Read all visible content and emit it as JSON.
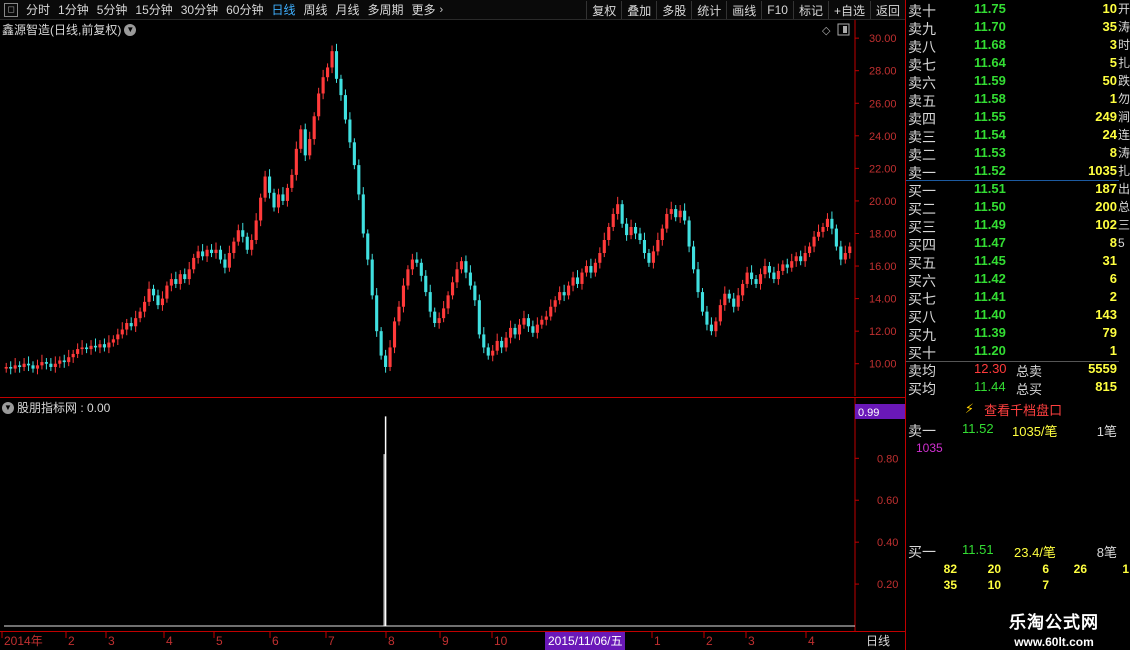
{
  "toolbar": {
    "periods": [
      "分时",
      "1分钟",
      "5分钟",
      "15分钟",
      "30分钟",
      "60分钟",
      "日线",
      "周线",
      "月线",
      "多周期",
      "更多"
    ],
    "active_index": 6,
    "right": [
      "复权",
      "叠加",
      "多股",
      "统计",
      "画线",
      "F10",
      "标记",
      "+自选",
      "返回"
    ]
  },
  "main_title": "鑫源智造(日线,前复权)",
  "indicator_title": "股朋指标网 : 0.00",
  "indicator_cursor_value": "0.99",
  "x_axis": {
    "labels": [
      "2014年",
      "2",
      "3",
      "4",
      "5",
      "6",
      "7",
      "8",
      "9",
      "10",
      "1",
      "2",
      "3",
      "4"
    ],
    "cursor_date": "2015/11/06/五",
    "period_label": "日线"
  },
  "colors": {
    "up": "#ff3a3a",
    "down": "#40e0e0",
    "grid": "#c00000",
    "accent_blue": "#3fb0ff"
  },
  "chart_data": [
    {
      "type": "candlestick",
      "y_ticks": [
        "30.00",
        "28.00",
        "26.00",
        "24.00",
        "22.00",
        "20.00",
        "18.00",
        "16.00",
        "14.00",
        "12.00",
        "10.00"
      ],
      "ylim": [
        9,
        30.5
      ],
      "close": [
        9.8,
        9.7,
        9.9,
        9.8,
        10.0,
        9.9,
        9.7,
        9.9,
        10.1,
        10.0,
        9.8,
        10.0,
        10.2,
        10.1,
        10.4,
        10.6,
        10.9,
        11.0,
        10.9,
        11.1,
        11.0,
        11.2,
        11.0,
        11.3,
        11.5,
        11.8,
        12.1,
        12.5,
        12.3,
        12.8,
        13.2,
        13.8,
        14.6,
        14.2,
        13.6,
        14.0,
        14.8,
        15.2,
        14.9,
        15.5,
        15.2,
        15.8,
        16.5,
        16.9,
        16.6,
        17.0,
        16.8,
        17.0,
        16.4,
        15.9,
        16.8,
        17.5,
        18.2,
        17.8,
        17.0,
        17.6,
        18.8,
        20.2,
        21.5,
        20.5,
        19.6,
        20.4,
        20.0,
        20.8,
        21.6,
        23.2,
        24.4,
        22.8,
        23.8,
        25.2,
        26.6,
        27.6,
        28.2,
        29.2,
        27.5,
        26.5,
        25.0,
        23.6,
        22.2,
        20.4,
        18.0,
        16.4,
        14.2,
        12.0,
        10.5,
        9.8,
        11.0,
        12.6,
        13.5,
        14.8,
        15.8,
        16.4,
        16.2,
        15.4,
        14.4,
        13.2,
        12.5,
        12.8,
        13.4,
        14.2,
        15.0,
        15.8,
        16.3,
        15.6,
        14.8,
        13.9,
        11.8,
        11.0,
        10.5,
        10.8,
        11.4,
        11.0,
        11.6,
        12.2,
        11.8,
        12.4,
        12.8,
        12.3,
        11.9,
        12.4,
        12.7,
        12.9,
        13.5,
        13.9,
        14.4,
        14.2,
        14.8,
        15.3,
        14.9,
        15.6,
        16.0,
        15.6,
        16.2,
        16.8,
        17.6,
        18.4,
        19.2,
        19.8,
        18.6,
        17.9,
        18.4,
        18.0,
        17.6,
        16.8,
        16.2,
        16.9,
        17.6,
        18.3,
        19.2,
        19.5,
        19.0,
        19.4,
        18.8,
        17.2,
        15.8,
        14.4,
        13.2,
        12.4,
        12.0,
        12.6,
        13.6,
        14.3,
        14.0,
        13.5,
        14.2,
        14.9,
        15.6,
        15.2,
        14.9,
        15.5,
        16.0,
        15.6,
        15.2,
        15.7,
        16.1,
        15.9,
        16.3,
        16.6,
        16.3,
        16.8,
        17.2,
        17.8,
        18.1,
        18.4,
        18.9,
        18.3,
        17.2,
        16.4,
        16.8,
        17.2
      ]
    },
    {
      "type": "bar",
      "y_ticks": [
        "0.80",
        "0.60",
        "0.40",
        "0.20"
      ],
      "ylim": [
        0,
        1.04
      ],
      "spike_index": 85,
      "spike_value": 1.0,
      "baseline": 0.0
    }
  ],
  "orderbook": {
    "asks": [
      {
        "label": "卖十",
        "price": "11.75",
        "vol": "10"
      },
      {
        "label": "卖九",
        "price": "11.70",
        "vol": "35"
      },
      {
        "label": "卖八",
        "price": "11.68",
        "vol": "3"
      },
      {
        "label": "卖七",
        "price": "11.64",
        "vol": "5"
      },
      {
        "label": "卖六",
        "price": "11.59",
        "vol": "50"
      },
      {
        "label": "卖五",
        "price": "11.58",
        "vol": "1"
      },
      {
        "label": "卖四",
        "price": "11.55",
        "vol": "249"
      },
      {
        "label": "卖三",
        "price": "11.54",
        "vol": "24"
      },
      {
        "label": "卖二",
        "price": "11.53",
        "vol": "8"
      },
      {
        "label": "卖一",
        "price": "11.52",
        "vol": "1035"
      }
    ],
    "bids": [
      {
        "label": "买一",
        "price": "11.51",
        "vol": "187"
      },
      {
        "label": "买二",
        "price": "11.50",
        "vol": "200"
      },
      {
        "label": "买三",
        "price": "11.49",
        "vol": "102"
      },
      {
        "label": "买四",
        "price": "11.47",
        "vol": "8"
      },
      {
        "label": "买五",
        "price": "11.45",
        "vol": "31"
      },
      {
        "label": "买六",
        "price": "11.42",
        "vol": "6"
      },
      {
        "label": "买七",
        "price": "11.41",
        "vol": "2"
      },
      {
        "label": "买八",
        "price": "11.40",
        "vol": "143"
      },
      {
        "label": "买九",
        "price": "11.39",
        "vol": "79"
      },
      {
        "label": "买十",
        "price": "11.20",
        "vol": "1"
      }
    ],
    "avg_sell_label": "卖均",
    "avg_sell_price": "12.30",
    "total_sell_label": "总卖",
    "total_sell": "5559",
    "avg_buy_label": "买均",
    "avg_buy_price": "11.44",
    "total_buy_label": "总买",
    "total_buy": "815"
  },
  "queue": {
    "button_label": "查看千档盘口",
    "sell_label": "卖一",
    "sell_price": "11.52",
    "sell_vol": "1035/笔",
    "sell_count": "1笔",
    "sell_orders": [
      "1035"
    ],
    "buy_label": "买一",
    "buy_price": "11.51",
    "buy_vol": "23.4/笔",
    "buy_count": "8笔",
    "buy_orders": [
      [
        "82",
        "20",
        "6",
        "26",
        "1"
      ],
      [
        "35",
        "10",
        "7"
      ]
    ]
  },
  "edge_chars": [
    "开",
    "涛",
    "时",
    "扎",
    "跌",
    "勿",
    "涧",
    "连",
    "涛",
    "扎",
    "出",
    "总",
    "三",
    "5"
  ],
  "watermark": {
    "line1": "乐淘公式网",
    "line2": "www.60lt.com"
  }
}
